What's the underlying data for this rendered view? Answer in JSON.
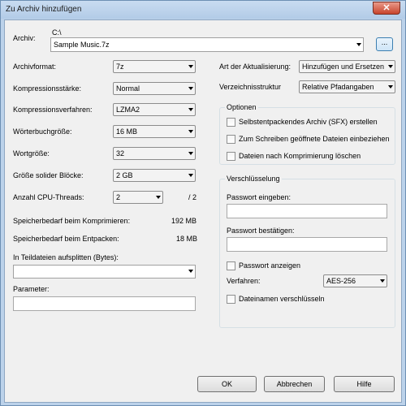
{
  "window": {
    "title": "Zu Archiv hinzufügen",
    "close_glyph": "✕"
  },
  "archive": {
    "label": "Archiv:",
    "path": "C:\\",
    "filename": "Sample Music.7z",
    "browse_label": "..."
  },
  "left": {
    "format_label": "Archivformat:",
    "format_value": "7z",
    "level_label": "Kompressionsstärke:",
    "level_value": "Normal",
    "method_label": "Kompressionsverfahren:",
    "method_value": "LZMA2",
    "dict_label": "Wörterbuchgröße:",
    "dict_value": "16 MB",
    "word_label": "Wortgröße:",
    "word_value": "32",
    "solid_label": "Größe solider Blöcke:",
    "solid_value": "2 GB",
    "threads_label": "Anzahl CPU-Threads:",
    "threads_value": "2",
    "threads_total": "/ 2",
    "mem_compress_label": "Speicherbedarf beim Komprimieren:",
    "mem_compress_value": "192 MB",
    "mem_decompress_label": "Speicherbedarf beim Entpacken:",
    "mem_decompress_value": "18 MB",
    "split_label": "In Teildateien aufsplitten (Bytes):",
    "split_value": "",
    "params_label": "Parameter:",
    "params_value": ""
  },
  "right": {
    "update_label": "Art der Aktualisierung:",
    "update_value": "Hinzufügen und Ersetzen",
    "paths_label": "Verzeichnisstruktur",
    "paths_value": "Relative Pfadangaben",
    "options": {
      "title": "Optionen",
      "sfx": "Selbstentpackendes Archiv (SFX) erstellen",
      "shared": "Zum Schreiben geöffnete Dateien einbeziehen",
      "delete": "Dateien nach Komprimierung löschen"
    },
    "encryption": {
      "title": "Verschlüsselung",
      "password_label": "Passwort eingeben:",
      "confirm_label": "Passwort bestätigen:",
      "show_label": "Passwort anzeigen",
      "method_label": "Verfahren:",
      "method_value": "AES-256",
      "encrypt_names": "Dateinamen verschlüsseln"
    }
  },
  "buttons": {
    "ok": "OK",
    "cancel": "Abbrechen",
    "help": "Hilfe"
  }
}
